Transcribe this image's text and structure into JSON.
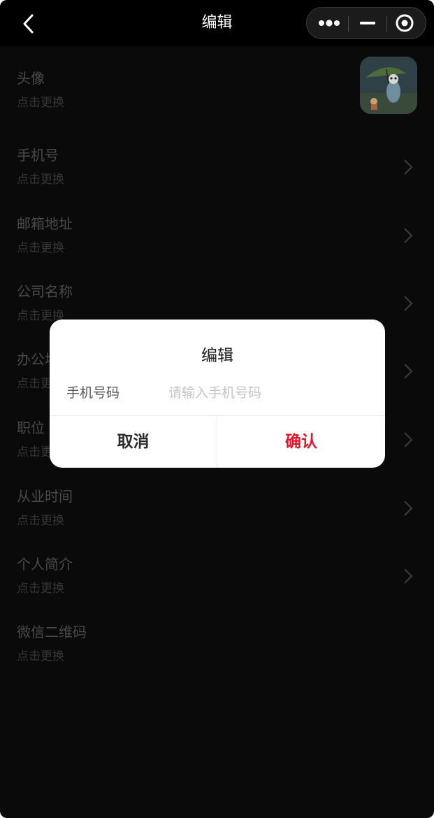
{
  "navbar": {
    "title": "编辑",
    "back_icon": "chevron-left-icon",
    "capsule": {
      "more_icon": "more-dots-icon",
      "minimize_icon": "minimize-icon",
      "close_icon": "target-circle-icon"
    }
  },
  "rows": [
    {
      "label": "头像",
      "hint": "点击更换"
    },
    {
      "label": "手机号",
      "hint": "点击更换"
    },
    {
      "label": "邮箱地址",
      "hint": "点击更换"
    },
    {
      "label": "公司名称",
      "hint": "点击更换"
    },
    {
      "label": "办公地址",
      "hint": "点击更换"
    },
    {
      "label": "职位",
      "hint": "点击更换"
    },
    {
      "label": "从业时间",
      "hint": "点击更换"
    },
    {
      "label": "个人简介",
      "hint": "点击更换"
    },
    {
      "label": "微信二维码",
      "hint": "点击更换"
    }
  ],
  "dialog": {
    "title": "编辑",
    "field_label": "手机号码",
    "field_value": "",
    "field_placeholder": "请输入手机号码",
    "cancel_label": "取消",
    "confirm_label": "确认"
  },
  "colors": {
    "background": "#0a0a0a",
    "navbar": "#000000",
    "accent": "#e0152b"
  }
}
